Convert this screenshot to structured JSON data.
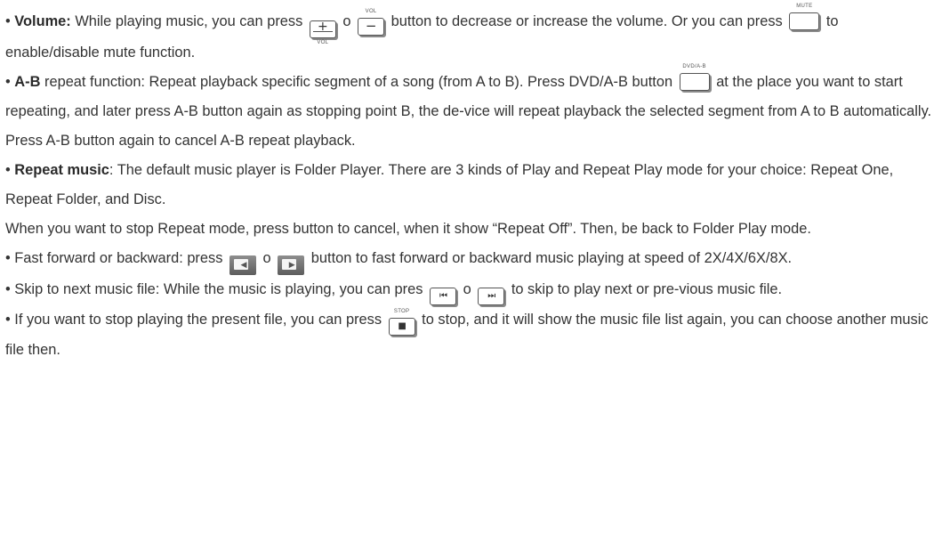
{
  "volume": {
    "heading": "Volume:",
    "t1": "While playing music, you can press",
    "plus_label": "+",
    "plus_caption": "VOL",
    "t2": "o",
    "minus_label": "−",
    "minus_caption": "VOL",
    "t3": "button to decrease or increase the volume. Or you can press",
    "mute_caption": "MUTE",
    "t4": "to enable/disable mute function."
  },
  "ab": {
    "heading": "A-B",
    "t1": "repeat function: Repeat playback specific segment of a song (from A to B). Press DVD/A-B button",
    "button_caption": "DVD/A-B",
    "t2": "at the place you want to start repeating, and later press A-B button again as stopping point B, the de-vice will repeat playback the selected segment from A to B automatically. Press A-B button again to cancel A-B repeat playback."
  },
  "repeat": {
    "heading": "Repeat music",
    "t1": ": The default music player is Folder Player. There are 3 kinds of Play and Repeat Play mode for your choice: Repeat One, Repeat Folder, and Disc."
  },
  "stop_repeat": {
    "text": "When you want to stop Repeat mode, press  button to cancel, when it show “Repeat Off”. Then, be back to Folder Play mode."
  },
  "fast": {
    "t1": "Fast forward or backward: press",
    "back_glyph": "◀",
    "t2": "o",
    "fwd_glyph": "▶",
    "t3": "button to fast forward or backward music playing at speed of 2X/4X/6X/8X."
  },
  "skip": {
    "t1": "Skip to next music file: While the music is playing, you can pres",
    "prev_glyph": "⏮",
    "t2": "o",
    "next_glyph": "⏭",
    "t3": "to skip to play next or pre-vious music file."
  },
  "stop": {
    "t1": "If you want to stop playing the present file, you can press",
    "stop_caption": "STOP",
    "stop_glyph": "■",
    "t2": "to stop, and it will show the music file list again, you can choose another music file then."
  }
}
